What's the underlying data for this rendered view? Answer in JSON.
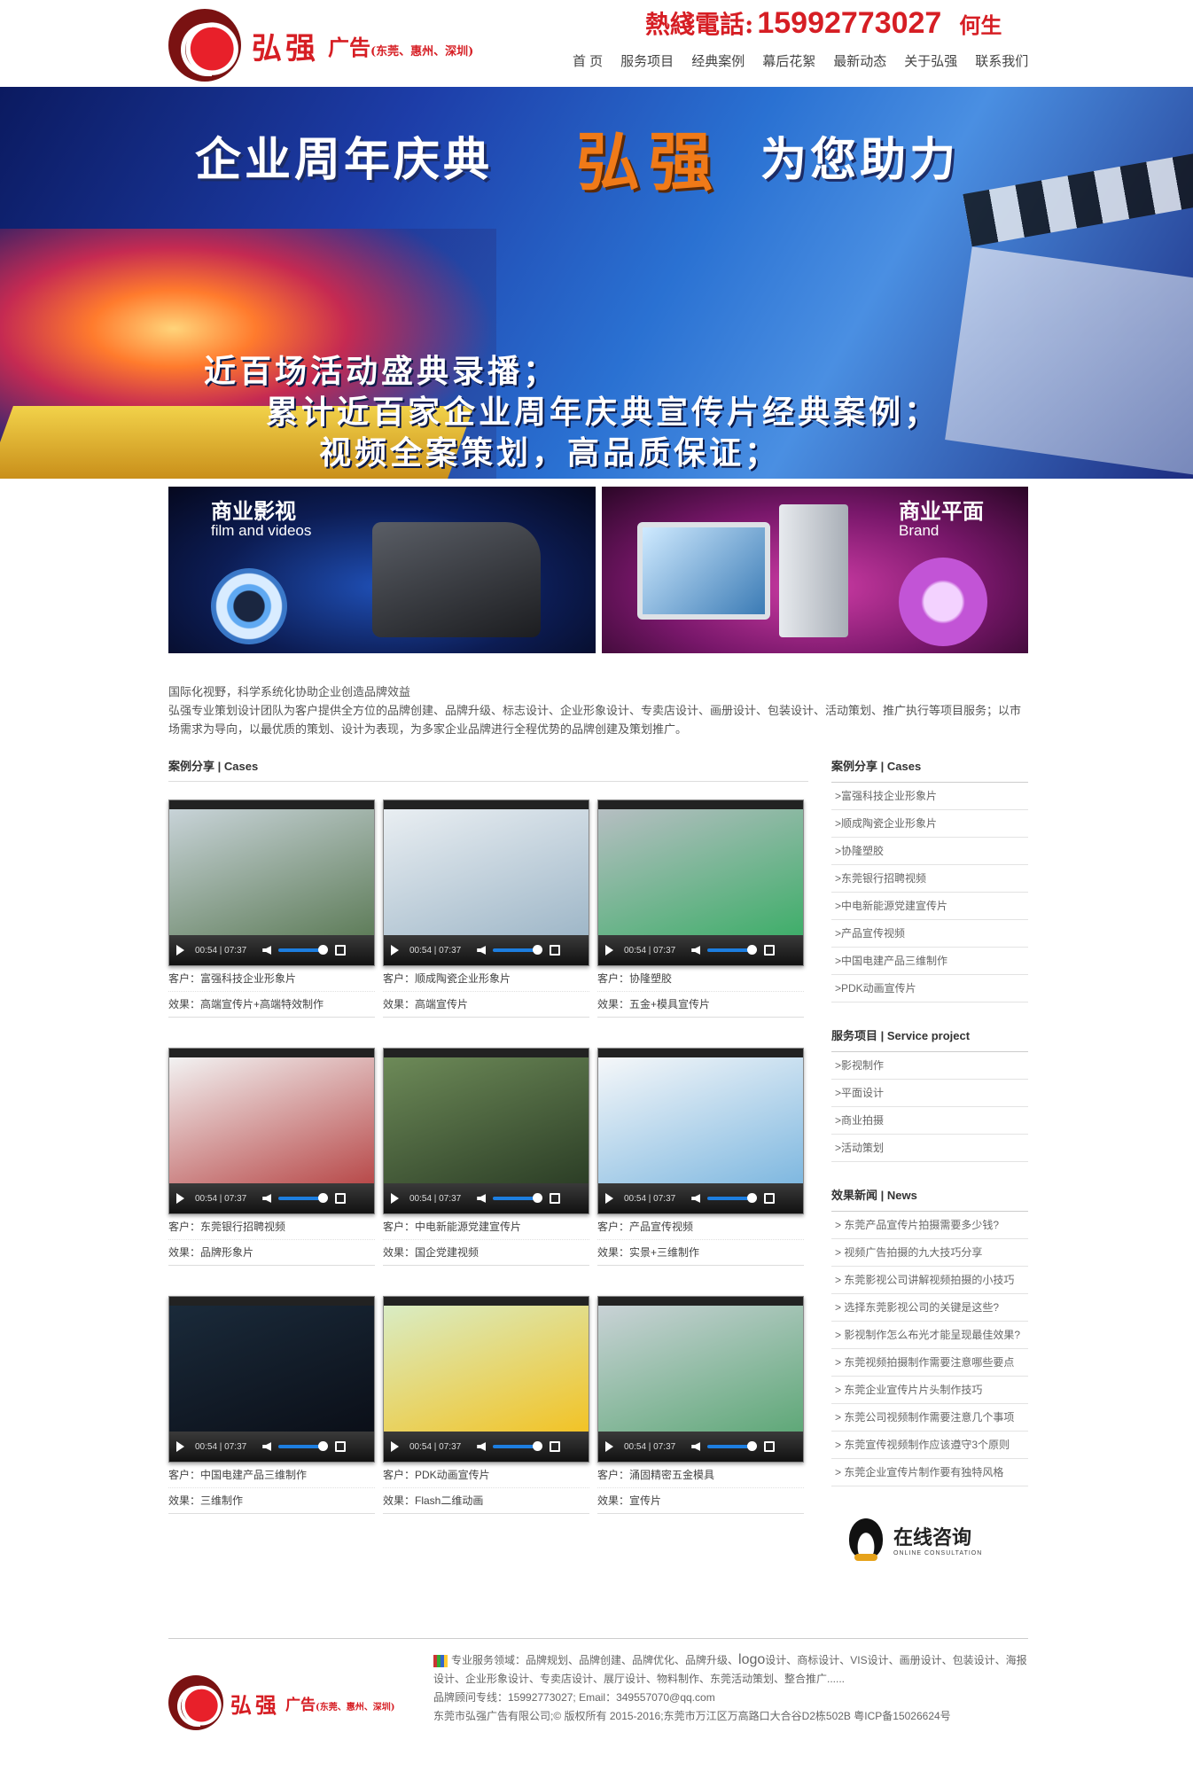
{
  "header": {
    "logo_name": "弘强",
    "logo_sub": "广告",
    "logo_region": "(东莞、惠州、深圳)",
    "hotline_label": "熱綫電話:",
    "hotline_number": "15992773027",
    "contact_name": "何生",
    "nav": [
      "首 页",
      "服务项目",
      "经典案例",
      "幕后花絮",
      "最新动态",
      "关于弘强",
      "联系我们"
    ]
  },
  "banner": {
    "title_left": "企业周年庆典",
    "title_brand": "弘强",
    "title_right": "为您助力",
    "lines": [
      "近百场活动盛典录播；",
      "累计近百家企业周年庆典宣传片经典案例；",
      "视频全案策划，高品质保证；"
    ]
  },
  "categories": [
    {
      "title": "商业影视",
      "subtitle": "film and videos"
    },
    {
      "title": "商业平面",
      "subtitle": "Brand"
    }
  ],
  "intro": {
    "line1": "国际化视野，科学系统化协助企业创造品牌效益",
    "line2": "弘强专业策划设计团队为客户提供全方位的品牌创建、品牌升级、标志设计、企业形象设计、专卖店设计、画册设计、包装设计、活动策划、推广执行等项目服务；以市场需求为导向，以最优质的策划、设计为表现，为多家企业品牌进行全程优势的品牌创建及策划推广。"
  },
  "cases": {
    "title": "案例分享 | Cases",
    "player_time": "00:54 | 07:37",
    "items": [
      {
        "client": "客户：富强科技企业形象片",
        "effect": "效果：高端宣传片+高端特效制作",
        "color1": "#c8d3d8",
        "color2": "#5f7d5a"
      },
      {
        "client": "客户：顺成陶瓷企业形象片",
        "effect": "效果：高端宣传片",
        "color1": "#e9eef2",
        "color2": "#9fb7c8"
      },
      {
        "client": "客户：协隆塑胶",
        "effect": "效果：五金+模具宣传片",
        "color1": "#b6bec2",
        "color2": "#3fae6a"
      },
      {
        "client": "客户：东莞银行招聘视频",
        "effect": "效果：品牌形象片",
        "color1": "#f2f2f2",
        "color2": "#b84a4a"
      },
      {
        "client": "客户：中电新能源党建宣传片",
        "effect": "效果：国企党建视频",
        "color1": "#6d8a58",
        "color2": "#2c3e26"
      },
      {
        "client": "客户：产品宣传视频",
        "effect": "效果：实景+三维制作",
        "color1": "#f5f7f9",
        "color2": "#7fb8e0"
      },
      {
        "client": "客户：中国电建产品三维制作",
        "effect": "效果：三维制作",
        "color1": "#1a2a3a",
        "color2": "#0b0f18"
      },
      {
        "client": "客户：PDK动画宣传片",
        "effect": "效果：Flash二维动画",
        "color1": "#d9ecc4",
        "color2": "#f2c326"
      },
      {
        "client": "客户：涌固精密五金模具",
        "effect": "效果：宣传片",
        "color1": "#c9d2d6",
        "color2": "#5fa878"
      }
    ]
  },
  "sidebar": {
    "cases_title": "案例分享 | Cases",
    "cases": [
      ">富强科技企业形象片",
      ">顺成陶瓷企业形象片",
      ">协隆塑胶",
      ">东莞银行招聘视频",
      ">中电新能源党建宣传片",
      ">产品宣传视频",
      ">中国电建产品三维制作",
      ">PDK动画宣传片"
    ],
    "services_title": "服务项目 | Service project",
    "services": [
      ">影视制作",
      ">平面设计",
      ">商业拍摄",
      ">活动策划"
    ],
    "news_title": "效果新闻 | News",
    "news": [
      "> 东莞产品宣传片拍摄需要多少钱?",
      "> 视频广告拍摄的九大技巧分享",
      "> 东莞影视公司讲解视频拍摄的小技巧",
      "> 选择东莞影视公司的关键是这些?",
      "> 影视制作怎么布光才能呈现最佳效果?",
      "> 东莞视频拍摄制作需要注意哪些要点",
      "> 东莞企业宣传片片头制作技巧",
      "> 东莞公司视频制作需要注意几个事项",
      "> 东莞宣传视频制作应该遵守3个原则",
      "> 东莞企业宣传片制作要有独特风格"
    ]
  },
  "consult": {
    "label": "在线咨询",
    "sublabel": "ONLINE CONSULTATION"
  },
  "footer": {
    "services_prefix": "专业服务领域：品牌规划、品牌创建、品牌优化、品牌升级、",
    "services_big": "logo",
    "services_suffix": "设计、商标设计、VIS设计、画册设计、包装设计、海报设计、企业形象设计、专卖店设计、展厅设计、物料制作、东莞活动策划、整合推广......",
    "contact": "品牌顾问专线：15992773027; Email：349557070@qq.com",
    "copyright": "东莞市弘强广告有限公司;© 版权所有 2015-2016;东莞市万江区万高路口大合谷D2栋502B 粤ICP备15026624号"
  }
}
